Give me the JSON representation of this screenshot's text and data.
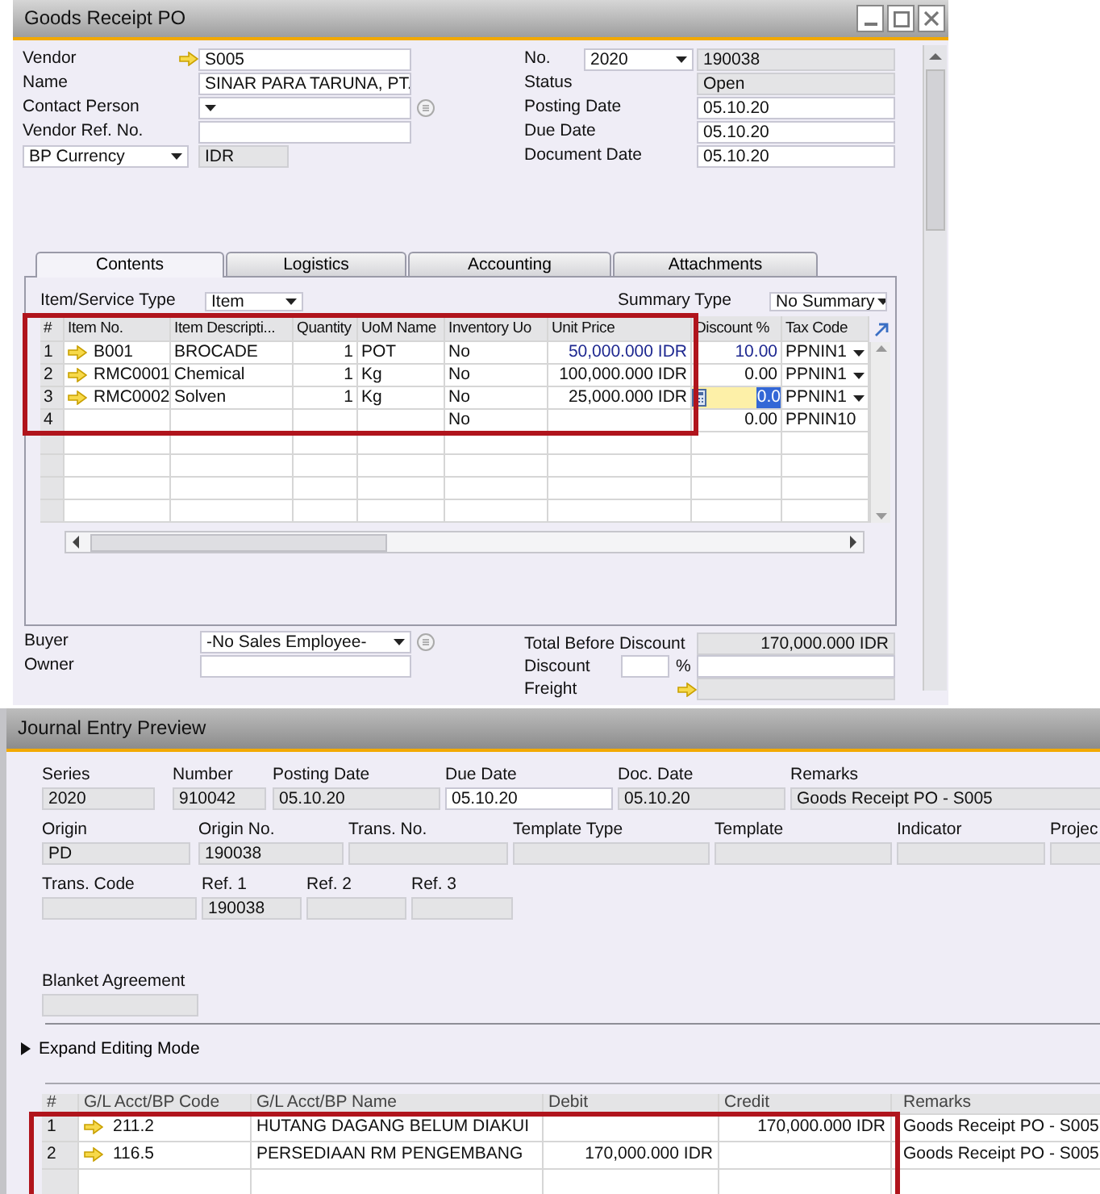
{
  "goods_receipt": {
    "title": "Goods Receipt PO",
    "header_left": [
      {
        "label": "Vendor",
        "value": "S005",
        "kind": "link"
      },
      {
        "label": "Name",
        "value": "SINAR PARA TARUNA, PT.",
        "kind": "text"
      },
      {
        "label": "Contact Person",
        "kind": "combo"
      },
      {
        "label": "Vendor Ref. No.",
        "kind": "text"
      },
      {
        "label": "BP Currency",
        "value": "IDR",
        "kind": "currency"
      }
    ],
    "header_right": [
      {
        "label": "No.",
        "series": "2020",
        "value": "190038",
        "kind": "series"
      },
      {
        "label": "Status",
        "value": "Open",
        "kind": "readonly"
      },
      {
        "label": "Posting Date",
        "value": "05.10.20",
        "kind": "text"
      },
      {
        "label": "Due Date",
        "value": "05.10.20",
        "kind": "text"
      },
      {
        "label": "Document Date",
        "value": "05.10.20",
        "kind": "text"
      }
    ],
    "tabs": [
      {
        "label": "Contents",
        "selected": true
      },
      {
        "label": "Logistics",
        "selected": false
      },
      {
        "label": "Accounting",
        "selected": false
      },
      {
        "label": "Attachments",
        "selected": false
      }
    ],
    "item_type": {
      "label": "Item/Service Type",
      "value": "Item"
    },
    "summary_type": {
      "label": "Summary Type",
      "value": "No Summary"
    },
    "table": {
      "columns": [
        "#",
        "Item No.",
        "Item Descripti...",
        "Quantity",
        "UoM Name",
        "Inventory Uo",
        "Unit Price",
        "Discount %",
        "Tax Code"
      ],
      "rows": [
        {
          "cells": [
            "1",
            "B001",
            "BROCADE",
            "1",
            "POT",
            "No",
            "50,000.000 IDR",
            "10.00",
            "PPNIN1"
          ],
          "link": true,
          "manual": true,
          "editing": false
        },
        {
          "cells": [
            "2",
            "RMC0001",
            "Chemical",
            "1",
            "Kg",
            "No",
            "100,000.000 IDR",
            "0.00",
            "PPNIN1"
          ],
          "link": true,
          "manual": false,
          "editing": false
        },
        {
          "cells": [
            "3",
            "RMC0002",
            "Solven",
            "1",
            "Kg",
            "No",
            "25,000.000 IDR",
            "0.0",
            "PPNIN1"
          ],
          "link": true,
          "manual": false,
          "editing": true
        },
        {
          "cells": [
            "4",
            "",
            "",
            "",
            "",
            "No",
            "",
            "0.00",
            "PPNIN10"
          ],
          "link": false,
          "manual": false,
          "editing": false
        }
      ]
    },
    "buyer": {
      "label": "Buyer",
      "value": "-No Sales Employee-"
    },
    "owner": {
      "label": "Owner"
    },
    "totals": [
      {
        "label": "Total Before Discount",
        "value": "170,000.000 IDR",
        "kind": "readonly"
      },
      {
        "label": "Discount",
        "percent_sign": "%",
        "kind": "percent"
      },
      {
        "label": "Freight",
        "kind": "link"
      }
    ]
  },
  "journal": {
    "title": "Journal Entry Preview",
    "field_rows": [
      [
        {
          "label": "Series",
          "value": "2020",
          "editable": false
        },
        {
          "label": "Number",
          "value": "910042",
          "editable": false
        },
        {
          "label": "Posting Date",
          "value": "05.10.20",
          "editable": false
        },
        {
          "label": "Due Date",
          "value": "05.10.20",
          "editable": true
        },
        {
          "label": "Doc. Date",
          "value": "05.10.20",
          "editable": false
        },
        {
          "label": "Remarks",
          "value": "Goods Receipt PO - S005",
          "editable": false
        }
      ],
      [
        {
          "label": "Origin",
          "value": "PD",
          "editable": false
        },
        {
          "label": "Origin No.",
          "value": "190038",
          "editable": false
        },
        {
          "label": "Trans. No.",
          "editable": false
        },
        {
          "label": "Template Type",
          "editable": false
        },
        {
          "label": "Template",
          "editable": false
        },
        {
          "label": "Indicator",
          "editable": false
        },
        {
          "label": "Projec",
          "editable": false
        }
      ],
      [
        {
          "label": "Trans. Code",
          "editable": false
        },
        {
          "label": "Ref. 1",
          "value": "190038",
          "editable": false
        },
        {
          "label": "Ref. 2",
          "editable": false
        },
        {
          "label": "Ref. 3",
          "editable": false
        }
      ]
    ],
    "blanket_agreement": {
      "label": "Blanket Agreement"
    },
    "expand": {
      "label": "Expand Editing Mode",
      "expanded": false
    },
    "table": {
      "columns": [
        "#",
        "G/L Acct/BP Code",
        "G/L Acct/BP Name",
        "Debit",
        "Credit",
        "Remarks"
      ],
      "rows": [
        {
          "cells": [
            "1",
            "211.2",
            "HUTANG DAGANG BELUM DIAKUI",
            "",
            "170,000.000 IDR",
            "Goods Receipt PO - S005"
          ],
          "link": true
        },
        {
          "cells": [
            "2",
            "116.5",
            "PERSEDIAAN RM PENGEMBANG",
            "170,000.000 IDR",
            "",
            "Goods Receipt PO - S005"
          ],
          "link": true
        }
      ]
    }
  }
}
